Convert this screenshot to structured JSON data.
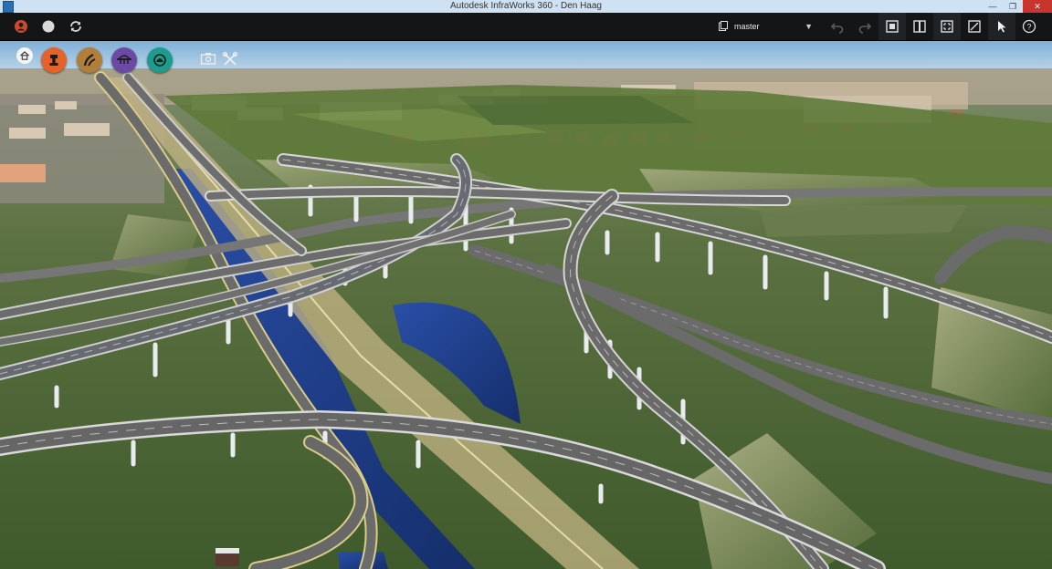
{
  "window": {
    "title": "Autodesk InfraWorks 360 - Den Haag",
    "controls": [
      "minimize-icon",
      "restore-icon",
      "close-icon"
    ]
  },
  "toolbar": {
    "left_icons": [
      "profile-icon",
      "circle-icon",
      "sync-icon"
    ],
    "branch_selector": {
      "icon": "branch-icon",
      "value": "master",
      "caret": "▼"
    },
    "right_icons": [
      "undo-icon",
      "redo-icon",
      "model-icon",
      "panel-icon",
      "fit-icon",
      "edit-icon",
      "select-pointer-icon",
      "help-icon"
    ]
  },
  "tools": [
    {
      "name": "home-icon",
      "color": "#f4f4f4"
    },
    {
      "name": "roads-tool-icon",
      "color": "#e4632b"
    },
    {
      "name": "intersection-tool-icon",
      "color": "#b27e3b"
    },
    {
      "name": "bridge-tool-icon",
      "color": "#6b4aa5"
    },
    {
      "name": "tunnel-tool-icon",
      "color": "#1c9c8c"
    },
    {
      "name": "capture-icon",
      "color": "#ffffff"
    },
    {
      "name": "settings-tools-icon",
      "color": "#ffffff"
    }
  ],
  "scene": {
    "description_label": "3D interchange model"
  },
  "colors": {
    "sky": "#9fc3df",
    "toolbar": "#131517",
    "water": "#1f3f8a",
    "grass": "#4f6b35"
  }
}
